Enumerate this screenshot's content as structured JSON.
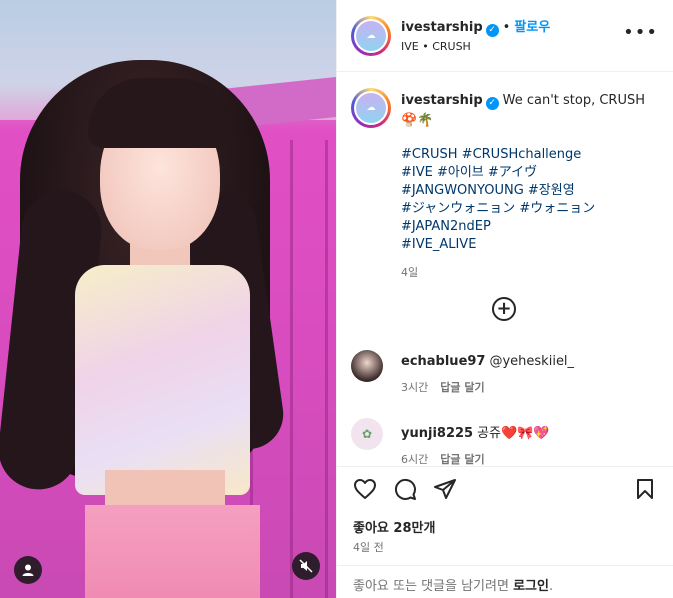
{
  "post": {
    "media": {
      "user_tag_icon": "person-icon",
      "mute_icon": "speaker-muted-icon"
    },
    "header": {
      "username": "ivestarship",
      "verified": "✓",
      "separator": "•",
      "follow_label": "팔로우",
      "subtitle": "IVE • CRUSH",
      "more_label": "•••"
    },
    "caption": {
      "username": "ivestarship",
      "verified": "✓",
      "text": "We can't stop, CRUSH",
      "emoji": "🍄🌴",
      "hashtag_lines": [
        "#CRUSH #CRUSHchallenge",
        "#IVE #아이브 #アイヴ",
        "#JANGWONYOUNG #장원영",
        "#ジャンウォニョン #ウォニョン",
        "#JAPAN2ndEP",
        "#IVE_ALIVE"
      ],
      "time": "4일"
    },
    "load_more_label": "+",
    "comments": [
      {
        "username": "echablue97",
        "text": "@yeheskiiel_",
        "time": "3시간",
        "reply_label": "답글 달기"
      },
      {
        "username": "yunji8225",
        "text": "공쥬❤️🎀💖",
        "time": "6시간",
        "reply_label": "답글 달기"
      }
    ],
    "footer": {
      "likes": "좋아요 28만개",
      "date": "4일 전",
      "login_prompt": "좋아요 또는 댓글을 남기려면 ",
      "login_link": "로그인",
      "login_suffix": "."
    }
  }
}
